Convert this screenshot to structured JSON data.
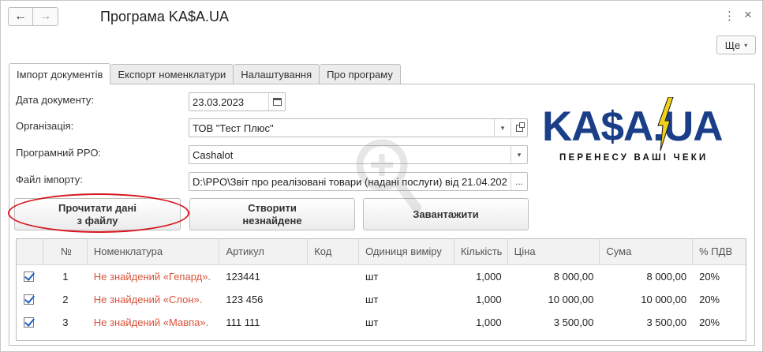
{
  "window": {
    "title": "Програма KA$A.UA",
    "back_icon": "←",
    "forward_icon": "→",
    "menu_icon": "⋮",
    "close_icon": "×",
    "more_label": "Ще",
    "more_caret": "▾"
  },
  "tabs": [
    {
      "label": "Імпорт документів",
      "active": true
    },
    {
      "label": "Експорт номенклатури",
      "active": false
    },
    {
      "label": "Налаштування",
      "active": false
    },
    {
      "label": "Про програму",
      "active": false
    }
  ],
  "form": {
    "date_label": "Дата документу:",
    "date_value": "23.03.2023",
    "org_label": "Організація:",
    "org_value": "ТОВ \"Тест Плюс\"",
    "rro_label": "Програмний РРО:",
    "rro_value": "Cashalot",
    "file_label": "Файл імпорту:",
    "file_value": "D:\\PPO\\Звіт про реалізовані товари  (надані послуги) від 21.04.202",
    "ellipsis": "...",
    "dropdown_caret": "▾"
  },
  "buttons": {
    "read_line1": "Прочитати дані",
    "read_line2": "з файлу",
    "create_line1": "Створити",
    "create_line2": "незнайдене",
    "load": "Завантажити"
  },
  "logo": {
    "text": "KA$A.UA",
    "tagline": "ПЕРЕНЕСУ ВАШІ ЧЕКИ",
    "brand_color": "#1a3e88",
    "accent_color": "#f2d11b"
  },
  "table": {
    "columns": [
      "",
      "№",
      "Номенклатура",
      "Артикул",
      "Код",
      "Одиниця виміру",
      "Кількість",
      "Ціна",
      "Сума",
      "% ПДВ"
    ],
    "rows": [
      {
        "checked": true,
        "n": "1",
        "name": "Не знайдений «Гепард».",
        "article": "123441",
        "code": "",
        "unit": "шт",
        "qty": "1,000",
        "price": "8 000,00",
        "sum": "8 000,00",
        "vat": "20%"
      },
      {
        "checked": true,
        "n": "2",
        "name": "Не знайдений «Слон».",
        "article": "123 456",
        "code": "",
        "unit": "шт",
        "qty": "1,000",
        "price": "10 000,00",
        "sum": "10 000,00",
        "vat": "20%"
      },
      {
        "checked": true,
        "n": "3",
        "name": "Не знайдений «Мавпа».",
        "article": "111 111",
        "code": "",
        "unit": "шт",
        "qty": "1,000",
        "price": "3 500,00",
        "sum": "3 500,00",
        "vat": "20%"
      }
    ]
  }
}
